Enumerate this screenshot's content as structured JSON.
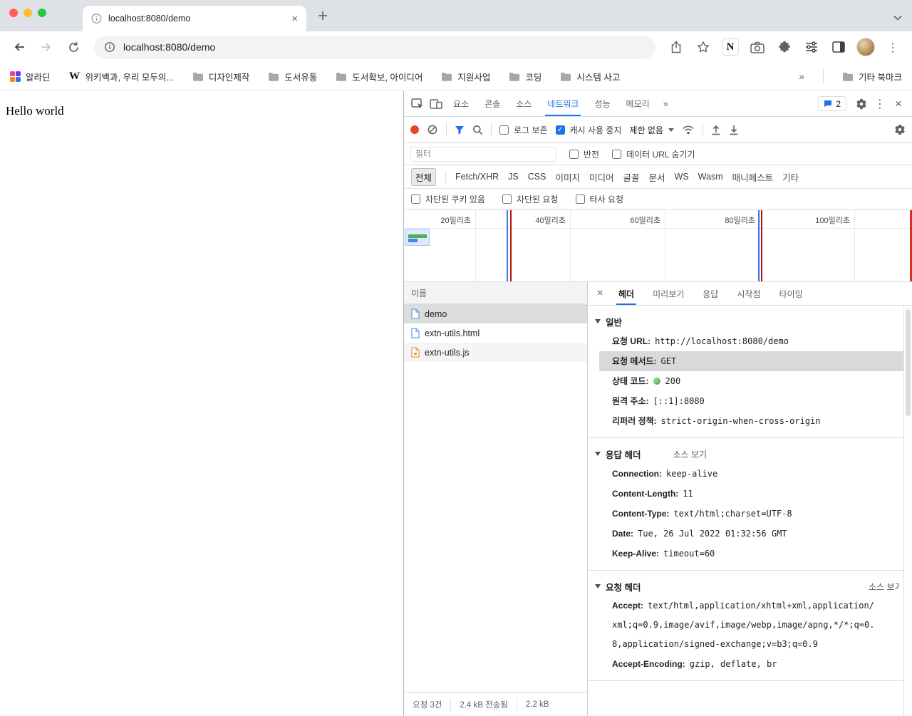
{
  "theme": {
    "accent": "#1a73e8",
    "record_red": "#e8442e",
    "status_green": "#3fa84c"
  },
  "icons": {
    "record": "filled-red-circle",
    "clear": "circle-slash",
    "filter": "funnel",
    "search": "magnifier",
    "settings": "gear",
    "more": "kebab",
    "close": "x",
    "inspect": "cursor-in-box",
    "device": "phone-tablet",
    "console_badge": "speech-bubble",
    "folder": "folder",
    "doc": "document",
    "script": "script-document",
    "network_conditions": "wifi-signal",
    "import_har": "arrow-up-tray",
    "export_har": "arrow-down-tray"
  },
  "browser": {
    "tab_title": "localhost:8080/demo",
    "url": "localhost:8080/demo",
    "bookmarks": [
      "알라딘",
      "위키백과, 우리 모두의...",
      "디자인제작",
      "도서유통",
      "도서확보, 아이디어",
      "지원사업",
      "코딩",
      "시스템 사고"
    ],
    "bookmarks_overflow": "»",
    "other_bookmarks": "기타 북마크"
  },
  "page": {
    "text": "Hello world"
  },
  "dt": {
    "tabs": [
      "요소",
      "콘솔",
      "소스",
      "네트워크",
      "성능",
      "메모리"
    ],
    "more_tabs": "»",
    "badge_count": "2",
    "toolbar": {
      "preserve_log": "로그 보존",
      "disable_cache": "캐시 사용 중지",
      "throttling": "제한 없음"
    },
    "filter": {
      "placeholder": "필터",
      "invert": "반전",
      "hide_data_urls": "데이터 URL 숨기기"
    },
    "chips": [
      "전체",
      "Fetch/XHR",
      "JS",
      "CSS",
      "이미지",
      "미디어",
      "글꼴",
      "문서",
      "WS",
      "Wasm",
      "매니페스트",
      "기타"
    ],
    "blocked": {
      "cookies": "차단된 쿠키 있음",
      "requests": "차단된 요청",
      "third_party": "타사 요청"
    },
    "ruler": [
      "20밀리초",
      "40밀리초",
      "60밀리초",
      "80밀리초",
      "100밀리초"
    ],
    "requests": {
      "header": "이름",
      "rows": [
        "demo",
        "extn-utils.html",
        "extn-utils.js"
      ]
    },
    "detail_tabs": [
      "헤더",
      "미리보기",
      "응답",
      "시작점",
      "타이밍"
    ],
    "general": {
      "title": "일반",
      "url_k": "요청 URL:",
      "url_v": "http://localhost:8080/demo",
      "method_k": "요청 메서드:",
      "method_v": "GET",
      "status_k": "상태 코드:",
      "status_v": "200",
      "remote_k": "원격 주소:",
      "remote_v": "[::1]:8080",
      "referrer_k": "리퍼러 정책:",
      "referrer_v": "strict-origin-when-cross-origin"
    },
    "response_headers": {
      "title": "응답 헤더",
      "view_source": "소스 보기",
      "rows": [
        [
          "Connection:",
          "keep-alive"
        ],
        [
          "Content-Length:",
          "11"
        ],
        [
          "Content-Type:",
          "text/html;charset=UTF-8"
        ],
        [
          "Date:",
          "Tue, 26 Jul 2022 01:32:56 GMT"
        ],
        [
          "Keep-Alive:",
          "timeout=60"
        ]
      ]
    },
    "request_headers": {
      "title": "요청 헤더",
      "view_source": "소스 보기",
      "rows": [
        [
          "Accept:",
          "text/html,application/xhtml+xml,application/xml;q=0.9,image/avif,image/webp,image/apng,*/*;q=0.8,application/signed-exchange;v=b3;q=0.9"
        ],
        [
          "Accept-Encoding:",
          "gzip, deflate, br"
        ]
      ]
    },
    "status": {
      "requests": "요청 3건",
      "transferred": "2.4 kB 전송됨",
      "resources": "2.2 kB"
    }
  }
}
